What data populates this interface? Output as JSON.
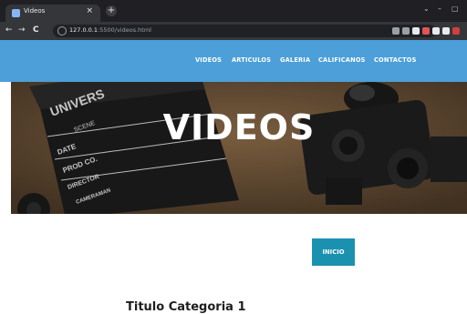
{
  "browser": {
    "tab_title": "Videos",
    "tab_close": "×",
    "new_tab": "+",
    "url_host": "127.0.0.1",
    "url_path": ":5500/videos.html",
    "win_min": "–",
    "win_max": "▢",
    "back": "←",
    "forward": "→",
    "reload": "C",
    "ext_colors": [
      "#9aa0a6",
      "#9aa0a6",
      "#e8eaed",
      "#e05555",
      "#e8eaed",
      "#e8eaed",
      "#d04040"
    ]
  },
  "nav": {
    "items": [
      "VIDEOS",
      "ARTICULOS",
      "GALERIA",
      "CALIFICANOS",
      "CONTACTOS"
    ]
  },
  "hero": {
    "title": "VIDEOS",
    "clapboard_text": [
      "UNIVERS",
      "SCENE",
      "DATE",
      "PROD CO.",
      "DIRECTOR",
      "CAMERAMAN"
    ]
  },
  "content": {
    "inicio_label": "INICIO",
    "category_title": "Titulo Categoria 1"
  },
  "colors": {
    "header_bg": "#4c9fd8",
    "button_bg": "#1b91b0",
    "cork": "#6b5239"
  }
}
